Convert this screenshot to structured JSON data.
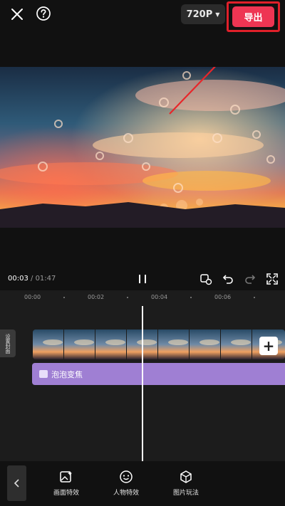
{
  "topbar": {
    "resolution_label": "720P",
    "export_label": "导出"
  },
  "playback": {
    "current_time": "00:03",
    "separator": " / ",
    "total_time": "01:47"
  },
  "timeline": {
    "ruler_labels": [
      "00:00",
      "00:02",
      "00:04",
      "00:06"
    ],
    "cover_label": "设置封面",
    "add_clip_label": "+",
    "effect_track_label": "泡泡变焦"
  },
  "toolbar": {
    "items": [
      {
        "label": "画面特效",
        "icon": "image-effect-icon"
      },
      {
        "label": "人物特效",
        "icon": "face-effect-icon"
      },
      {
        "label": "图片玩法",
        "icon": "cube-icon"
      }
    ]
  },
  "colors": {
    "export_button": "#ee3553",
    "highlight_box": "#e0202a",
    "effect_track": "#9f7fd3"
  }
}
